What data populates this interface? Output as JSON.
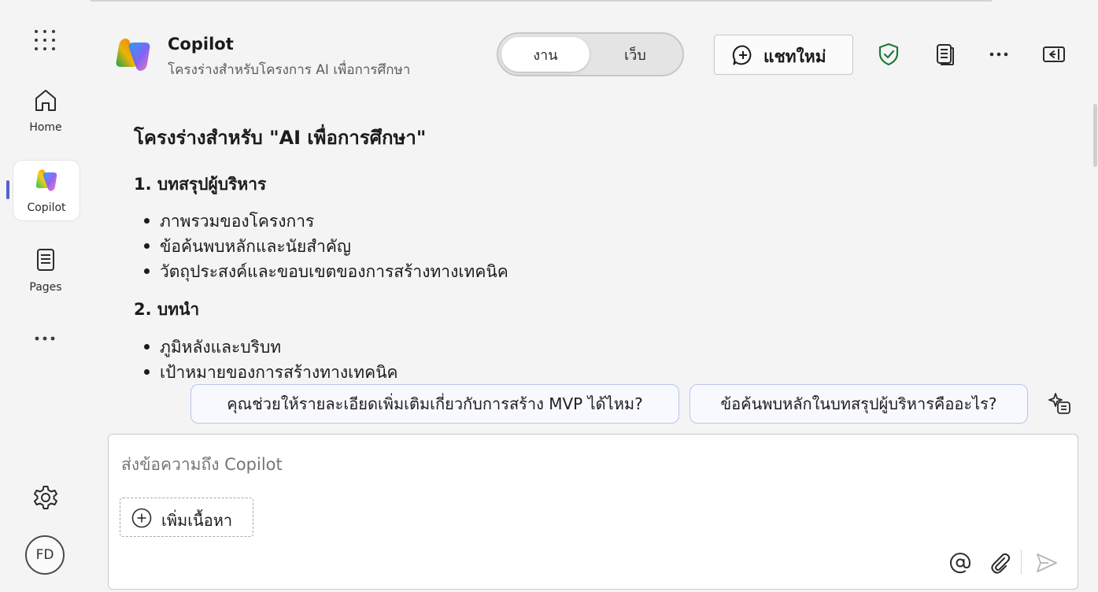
{
  "rail": {
    "home_label": "Home",
    "copilot_label": "Copilot",
    "pages_label": "Pages",
    "avatar_initials": "FD"
  },
  "header": {
    "title": "Copilot",
    "subtitle": "โครงร่างสำหรับโครงการ AI เพื่อการศึกษา",
    "toggle": {
      "work": "งาน",
      "web": "เว็บ",
      "selected": "งาน"
    },
    "new_chat": "แชทใหม่"
  },
  "content": {
    "title": "โครงร่างสำหรับ \"AI เพื่อการศึกษา\"",
    "sections": [
      {
        "heading": "1. บทสรุปผู้บริหาร",
        "items": [
          "ภาพรวมของโครงการ",
          "ข้อค้นพบหลักและนัยสำคัญ",
          "วัตถุประสงค์และขอบเขตของการสร้างทางเทคนิค"
        ]
      },
      {
        "heading": "2. บทนำ",
        "items": [
          "ภูมิหลังและบริบท",
          "เป้าหมายของการสร้างทางเทคนิค"
        ]
      }
    ]
  },
  "suggestions": [
    "คุณช่วยให้รายละเอียดเพิ่มเติมเกี่ยวกับการสร้าง MVP ได้ไหม?",
    "ข้อค้นพบหลักในบทสรุปผู้บริหารคืออะไร?"
  ],
  "composer": {
    "placeholder": "ส่งข้อความถึง Copilot",
    "value": "",
    "add_content": "เพิ่มเนื้อหา"
  },
  "colors": {
    "accent": "#5b5fc7",
    "shield": "#1f7a3a",
    "chip_border": "#b9c4ec"
  }
}
